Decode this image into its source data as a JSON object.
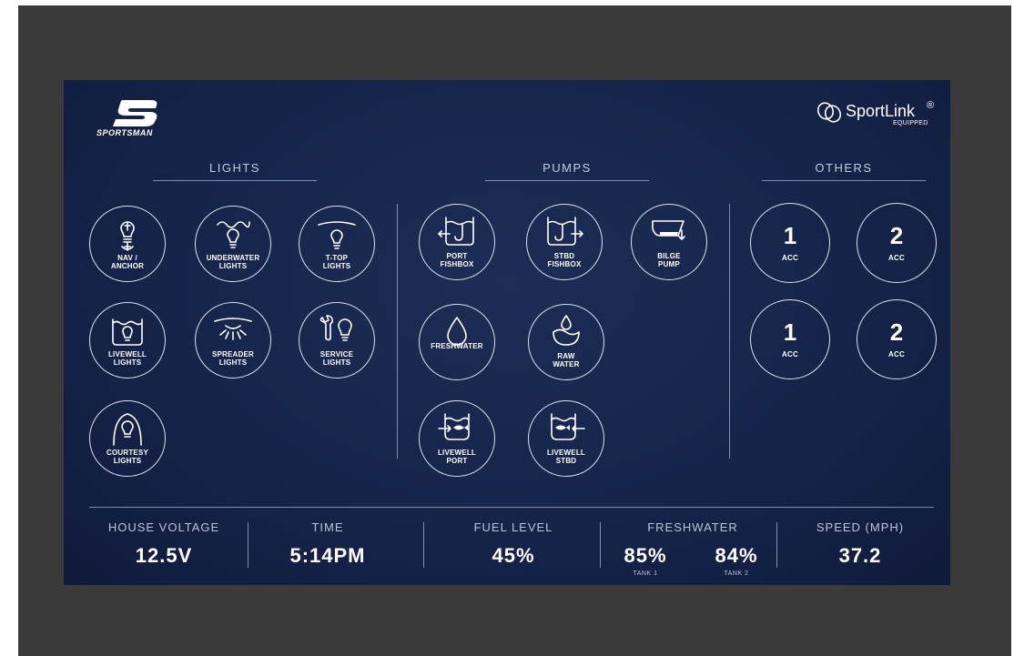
{
  "brand": {
    "logo_text": "SPORTSMAN",
    "partner_name": "SportLink",
    "partner_mark": "®",
    "partner_sub": "EQUIPPED"
  },
  "sections": {
    "lights": "LIGHTS",
    "pumps": "PUMPS",
    "others": "OTHERS"
  },
  "lights": [
    {
      "label": "NAV /\nANCHOR",
      "icon": "anchor-bulb-icon"
    },
    {
      "label": "UNDERWATER\nLIGHTS",
      "icon": "underwater-bulb-icon"
    },
    {
      "label": "T-TOP\nLIGHTS",
      "icon": "ttop-bulb-icon"
    },
    {
      "label": "LIVEWELL\nLIGHTS",
      "icon": "livewell-bulb-icon"
    },
    {
      "label": "SPREADER\nLIGHTS",
      "icon": "spreader-light-icon"
    },
    {
      "label": "SERVICE\nLIGHTS",
      "icon": "wrench-bulb-icon"
    },
    {
      "label": "COURTESY\nLIGHTS",
      "icon": "courtesy-bulb-icon"
    }
  ],
  "pumps": [
    {
      "label": "PORT\nFISHBOX",
      "icon": "port-fishbox-icon"
    },
    {
      "label": "STBD\nFISHBOX",
      "icon": "stbd-fishbox-icon"
    },
    {
      "label": "BILGE\nPUMP",
      "icon": "bilge-pump-icon"
    },
    {
      "label": "FRESHWATER",
      "icon": "water-drop-icon"
    },
    {
      "label": "RAW\nWATER",
      "icon": "raw-water-icon"
    },
    {
      "label": "LIVEWELL\nPORT",
      "icon": "livewell-port-icon"
    },
    {
      "label": "LIVEWELL\nSTBD",
      "icon": "livewell-stbd-icon"
    }
  ],
  "others": [
    {
      "number": "1",
      "label": "ACC"
    },
    {
      "number": "2",
      "label": "ACC"
    },
    {
      "number": "1",
      "label": "ACC"
    },
    {
      "number": "2",
      "label": "ACC"
    }
  ],
  "stats": {
    "house_voltage": {
      "label": "HOUSE VOLTAGE",
      "value": "12.5V"
    },
    "time": {
      "label": "TIME",
      "value": "5:14PM"
    },
    "fuel": {
      "label": "FUEL LEVEL",
      "value": "45%"
    },
    "freshwater": {
      "label": "FRESHWATER",
      "tank1_value": "85%",
      "tank1_label": "TANK 1",
      "tank2_value": "84%",
      "tank2_label": "TANK 2"
    },
    "speed": {
      "label": "SPEED (MPH)",
      "value": "37.2"
    }
  },
  "colors": {
    "screen_bg": "#16244a",
    "bezel": "#3a3a3a",
    "line": "#7d8fb1",
    "text": "#ffffff"
  }
}
